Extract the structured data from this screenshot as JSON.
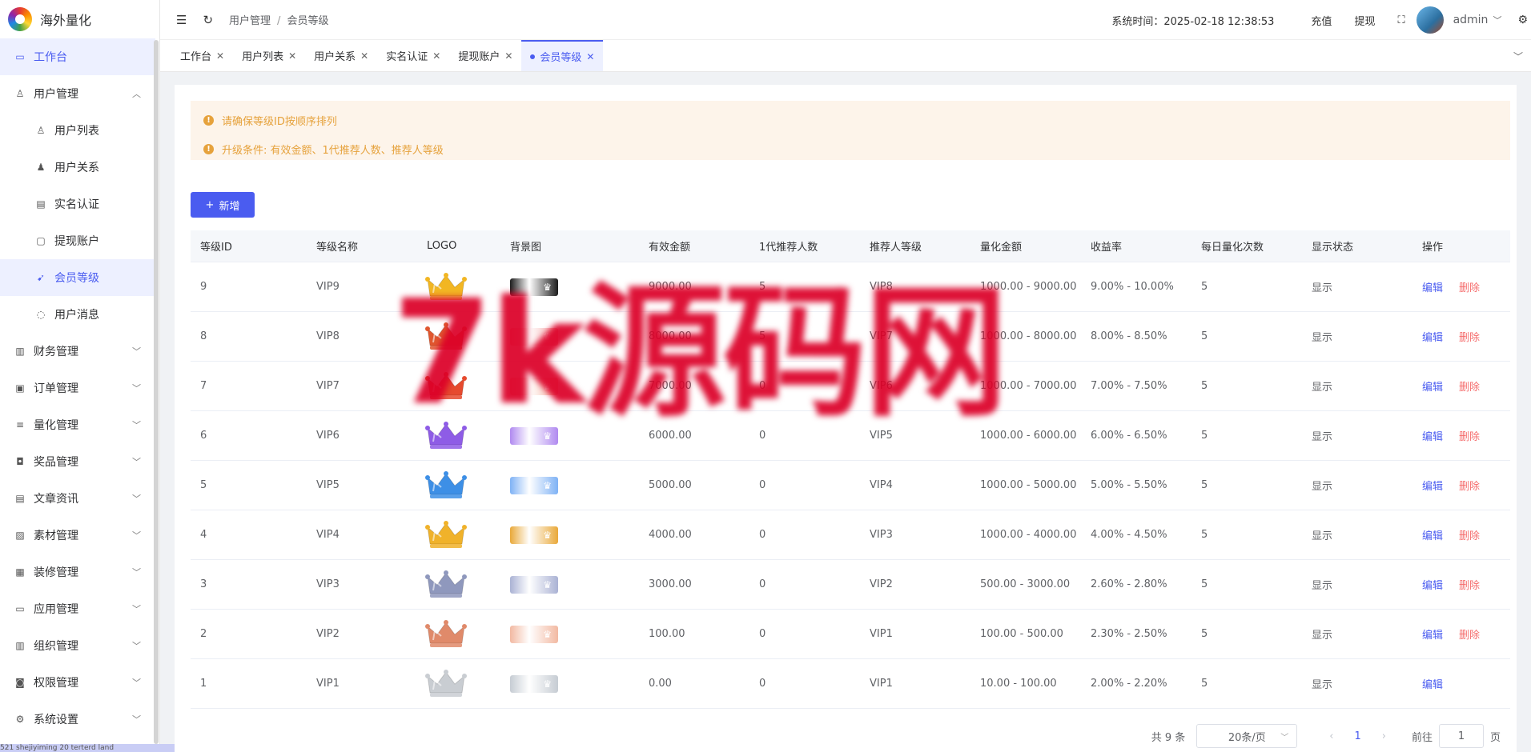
{
  "app": {
    "name": "海外量化"
  },
  "sidebar": {
    "items": [
      {
        "label": "工作台",
        "icon": "monitor-icon",
        "level": 0,
        "active": true,
        "expand": ""
      },
      {
        "label": "用户管理",
        "icon": "user-icon",
        "level": 0,
        "active": false,
        "expand": "up"
      },
      {
        "label": "用户列表",
        "icon": "user-list-icon",
        "level": 1,
        "active": false,
        "expand": ""
      },
      {
        "label": "用户关系",
        "icon": "users-relation-icon",
        "level": 1,
        "active": false,
        "expand": ""
      },
      {
        "label": "实名认证",
        "icon": "id-card-icon",
        "level": 1,
        "active": false,
        "expand": ""
      },
      {
        "label": "提现账户",
        "icon": "folder-icon",
        "level": 1,
        "active": false,
        "expand": ""
      },
      {
        "label": "会员等级",
        "icon": "rocket-icon",
        "level": 1,
        "active": true,
        "expand": ""
      },
      {
        "label": "用户消息",
        "icon": "chat-icon",
        "level": 1,
        "active": false,
        "expand": ""
      },
      {
        "label": "财务管理",
        "icon": "chart-icon",
        "level": 0,
        "active": false,
        "expand": "down"
      },
      {
        "label": "订单管理",
        "icon": "order-icon",
        "level": 0,
        "active": false,
        "expand": "down"
      },
      {
        "label": "量化管理",
        "icon": "quant-icon",
        "level": 0,
        "active": false,
        "expand": "down"
      },
      {
        "label": "奖品管理",
        "icon": "bag-icon",
        "level": 0,
        "active": false,
        "expand": "down"
      },
      {
        "label": "文章资讯",
        "icon": "article-icon",
        "level": 0,
        "active": false,
        "expand": "down"
      },
      {
        "label": "素材管理",
        "icon": "image-icon",
        "level": 0,
        "active": false,
        "expand": "down"
      },
      {
        "label": "装修管理",
        "icon": "decor-icon",
        "level": 0,
        "active": false,
        "expand": "down"
      },
      {
        "label": "应用管理",
        "icon": "app-icon",
        "level": 0,
        "active": false,
        "expand": "down"
      },
      {
        "label": "组织管理",
        "icon": "org-icon",
        "level": 0,
        "active": false,
        "expand": "down"
      },
      {
        "label": "权限管理",
        "icon": "lock-icon",
        "level": 0,
        "active": false,
        "expand": "down"
      },
      {
        "label": "系统设置",
        "icon": "gear-icon",
        "level": 0,
        "active": false,
        "expand": "down"
      }
    ]
  },
  "header": {
    "breadcrumb": [
      "用户管理",
      "会员等级"
    ],
    "sys_time_label": "系统时间：",
    "sys_time": "2025-02-18 12:38:53",
    "recharge": "充值",
    "withdraw": "提现",
    "user": "admin"
  },
  "tabs": [
    {
      "label": "工作台",
      "active": false
    },
    {
      "label": "用户列表",
      "active": false
    },
    {
      "label": "用户关系",
      "active": false
    },
    {
      "label": "实名认证",
      "active": false
    },
    {
      "label": "提现账户",
      "active": false
    },
    {
      "label": "会员等级",
      "active": true
    }
  ],
  "notices": [
    "请确保等级ID按顺序排列",
    "升级条件: 有效金额、1代推荐人数、推荐人等级"
  ],
  "add_button": "新增",
  "table": {
    "columns": [
      "等级ID",
      "等级名称",
      "LOGO",
      "背景图",
      "有效金额",
      "1代推荐人数",
      "推荐人等级",
      "量化金额",
      "收益率",
      "每日量化次数",
      "显示状态",
      "操作"
    ],
    "edit_label": "编辑",
    "delete_label": "删除",
    "rows": [
      {
        "id": "9",
        "name": "VIP9",
        "amount": "9000.00",
        "referrals": "5",
        "ref_level": "VIP8",
        "quant": "1000.00 - 9000.00",
        "rate": "9.00% - 10.00%",
        "daily": "5",
        "status": "显示",
        "crown": "#f2b623",
        "bg": "#1d1d1d",
        "deletable": true
      },
      {
        "id": "8",
        "name": "VIP8",
        "amount": "8000.00",
        "referrals": "5",
        "ref_level": "VIP7",
        "quant": "1000.00 - 8000.00",
        "rate": "8.00% - 8.50%",
        "daily": "5",
        "status": "显示",
        "crown": "#e0572f",
        "bg": "#f4a8a8",
        "deletable": true
      },
      {
        "id": "7",
        "name": "VIP7",
        "amount": "7000.00",
        "referrals": "0",
        "ref_level": "VIP6",
        "quant": "1000.00 - 7000.00",
        "rate": "7.00% - 7.50%",
        "daily": "5",
        "status": "显示",
        "crown": "#e64a2e",
        "bg": "#f6b7a4",
        "deletable": true
      },
      {
        "id": "6",
        "name": "VIP6",
        "amount": "6000.00",
        "referrals": "0",
        "ref_level": "VIP5",
        "quant": "1000.00 - 6000.00",
        "rate": "6.00% - 6.50%",
        "daily": "5",
        "status": "显示",
        "crown": "#8e5ce6",
        "bg": "#b08af0",
        "deletable": true
      },
      {
        "id": "5",
        "name": "VIP5",
        "amount": "5000.00",
        "referrals": "0",
        "ref_level": "VIP4",
        "quant": "1000.00 - 5000.00",
        "rate": "5.00% - 5.50%",
        "daily": "5",
        "status": "显示",
        "crown": "#3d8fe6",
        "bg": "#7fb2f5",
        "deletable": true
      },
      {
        "id": "4",
        "name": "VIP4",
        "amount": "4000.00",
        "referrals": "0",
        "ref_level": "VIP3",
        "quant": "1000.00 - 4000.00",
        "rate": "4.00% - 4.50%",
        "daily": "5",
        "status": "显示",
        "crown": "#f0b22a",
        "bg": "#e9a93a",
        "deletable": true
      },
      {
        "id": "3",
        "name": "VIP3",
        "amount": "3000.00",
        "referrals": "0",
        "ref_level": "VIP2",
        "quant": "500.00 - 3000.00",
        "rate": "2.60% - 2.80%",
        "daily": "5",
        "status": "显示",
        "crown": "#8f98bd",
        "bg": "#aab2d4",
        "deletable": true
      },
      {
        "id": "2",
        "name": "VIP2",
        "amount": "100.00",
        "referrals": "0",
        "ref_level": "VIP1",
        "quant": "100.00 - 500.00",
        "rate": "2.30% - 2.50%",
        "daily": "5",
        "status": "显示",
        "crown": "#e08a6a",
        "bg": "#f2b9a2",
        "deletable": true
      },
      {
        "id": "1",
        "name": "VIP1",
        "amount": "0.00",
        "referrals": "0",
        "ref_level": "VIP1",
        "quant": "10.00 - 100.00",
        "rate": "2.00% - 2.20%",
        "daily": "5",
        "status": "显示",
        "crown": "#c9cdd2",
        "bg": "#c6ccd3",
        "deletable": false
      }
    ]
  },
  "pager": {
    "total": "共 9 条",
    "size": "20条/页",
    "current": "1",
    "goto": "前往",
    "goto_value": "1",
    "page_unit": "页"
  },
  "watermark": "7k源码网",
  "bottom_url": "521 shejiyiming 20 terterd land"
}
